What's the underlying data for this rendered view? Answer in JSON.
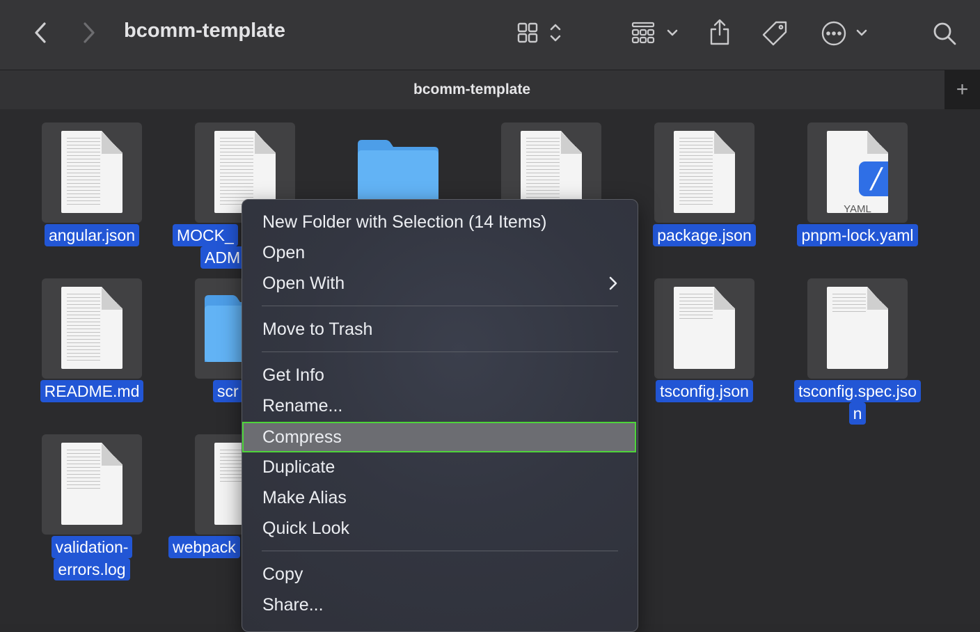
{
  "window": {
    "title": "bcomm-template",
    "tab_title": "bcomm-template",
    "new_tab_label": "+"
  },
  "toolbar": {
    "icons": [
      "back-chevron-icon",
      "forward-chevron-icon",
      "icon-view-grid-icon",
      "sort-updown-icon",
      "group-icon",
      "chevron-down-icon",
      "share-icon",
      "tag-icon",
      "more-icon",
      "search-icon"
    ]
  },
  "files": [
    {
      "name_line1": "angular.json",
      "name_line2": "",
      "kind": "doc"
    },
    {
      "name_line1": "MOCK_",
      "name_line2": "ADM",
      "kind": "doc"
    },
    {
      "name_line1": "",
      "name_line2": "",
      "kind": "folder"
    },
    {
      "name_line1": "",
      "name_line2": "",
      "kind": "doc"
    },
    {
      "name_line1": "package.json",
      "name_line2": "",
      "kind": "doc"
    },
    {
      "name_line1": "pnpm-lock.yaml",
      "name_line2": "",
      "kind": "yaml",
      "badge": "YAML"
    },
    {
      "name_line1": "README.md",
      "name_line2": "",
      "kind": "doc"
    },
    {
      "name_line1": "scr",
      "name_line2": "",
      "kind": "folder"
    },
    {
      "name_line1": "tsconfig.json",
      "name_line2": "",
      "kind": "doc"
    },
    {
      "name_line1": "tsconfig.spec.jso",
      "name_line2": "n",
      "kind": "doc"
    },
    {
      "name_line1": "validation-",
      "name_line2": "errors.log",
      "kind": "doc"
    },
    {
      "name_line1": "webpack",
      "name_line2": "",
      "kind": "doc"
    }
  ],
  "context_menu": {
    "items": [
      {
        "label": "New Folder with Selection (14 Items)"
      },
      {
        "label": "Open"
      },
      {
        "label": "Open With",
        "submenu": true
      },
      {
        "label": "Move to Trash"
      },
      {
        "label": "Get Info"
      },
      {
        "label": "Rename..."
      },
      {
        "label": "Compress",
        "highlighted": true
      },
      {
        "label": "Duplicate"
      },
      {
        "label": "Make Alias"
      },
      {
        "label": "Quick Look"
      },
      {
        "label": "Copy"
      },
      {
        "label": "Share..."
      }
    ]
  },
  "colors": {
    "selection": "#2256d5",
    "highlight_border": "#4ed43a",
    "folder": "#5fb0f2"
  }
}
